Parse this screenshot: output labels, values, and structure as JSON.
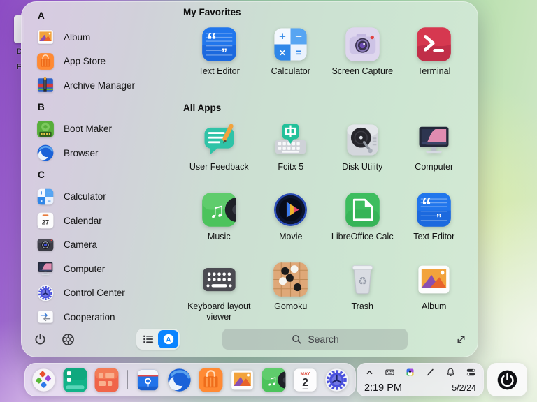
{
  "desktop": {
    "partial_icon_labels": [
      "D",
      "F"
    ]
  },
  "launcher": {
    "favorites_title": "My Favorites",
    "all_apps_title": "All Apps",
    "sidebar": [
      {
        "type": "header",
        "label": "A"
      },
      {
        "type": "app",
        "label": "Album",
        "icon": "album-icon"
      },
      {
        "type": "app",
        "label": "App Store",
        "icon": "app-store-icon"
      },
      {
        "type": "app",
        "label": "Archive Manager",
        "icon": "archive-manager-icon"
      },
      {
        "type": "header",
        "label": "B"
      },
      {
        "type": "app",
        "label": "Boot Maker",
        "icon": "boot-maker-icon"
      },
      {
        "type": "app",
        "label": "Browser",
        "icon": "browser-icon"
      },
      {
        "type": "header",
        "label": "C"
      },
      {
        "type": "app",
        "label": "Calculator",
        "icon": "calculator-icon"
      },
      {
        "type": "app",
        "label": "Calendar",
        "icon": "calendar-27-icon"
      },
      {
        "type": "app",
        "label": "Camera",
        "icon": "camera-icon"
      },
      {
        "type": "app",
        "label": "Computer",
        "icon": "computer-icon"
      },
      {
        "type": "app",
        "label": "Control Center",
        "icon": "control-center-icon"
      },
      {
        "type": "app",
        "label": "Cooperation",
        "icon": "cooperation-icon"
      }
    ],
    "favorites": [
      {
        "label": "Text Editor",
        "icon": "text-editor-icon"
      },
      {
        "label": "Calculator",
        "icon": "calculator-icon"
      },
      {
        "label": "Screen Capture",
        "icon": "screen-capture-icon"
      },
      {
        "label": "Terminal",
        "icon": "terminal-icon"
      }
    ],
    "all_apps": [
      {
        "label": "User Feedback",
        "icon": "user-feedback-icon"
      },
      {
        "label": "Fcitx 5",
        "icon": "fcitx-icon"
      },
      {
        "label": "Disk Utility",
        "icon": "disk-utility-icon"
      },
      {
        "label": "Computer",
        "icon": "computer-icon"
      },
      {
        "label": "Music",
        "icon": "music-icon"
      },
      {
        "label": "Movie",
        "icon": "movie-icon"
      },
      {
        "label": "LibreOffice Calc",
        "icon": "libreoffice-calc-icon"
      },
      {
        "label": "Text Editor",
        "icon": "text-editor-icon"
      },
      {
        "label": "Keyboard layout viewer",
        "icon": "keyboard-layout-icon"
      },
      {
        "label": "Gomoku",
        "icon": "gomoku-icon"
      },
      {
        "label": "Trash",
        "icon": "trash-icon"
      },
      {
        "label": "Album",
        "icon": "album-icon"
      }
    ],
    "footer": {
      "search_placeholder": "Search"
    }
  },
  "badges": {
    "fcitx": "中",
    "calendar_sidebar_day": "27",
    "calendar_dock_month": "MAY",
    "calendar_dock_day": "2",
    "launcher_toggle_letter": "A"
  },
  "taskbar": {
    "dock": [
      "launcher-icon",
      "green-list-app-icon",
      "app-grid-icon",
      "separator",
      "file-manager-icon",
      "browser-icon",
      "app-store-icon",
      "album-icon",
      "music-icon",
      "calendar-icon",
      "control-center-icon"
    ],
    "tray": [
      "chevron-up-icon",
      "keyboard-icon",
      "input-method-icon",
      "pen-icon",
      "bell-icon",
      "toggles-icon"
    ],
    "time": "2:19 PM",
    "date": "5/2/24"
  },
  "colors": {
    "accent_blue": "#0a84ff"
  }
}
